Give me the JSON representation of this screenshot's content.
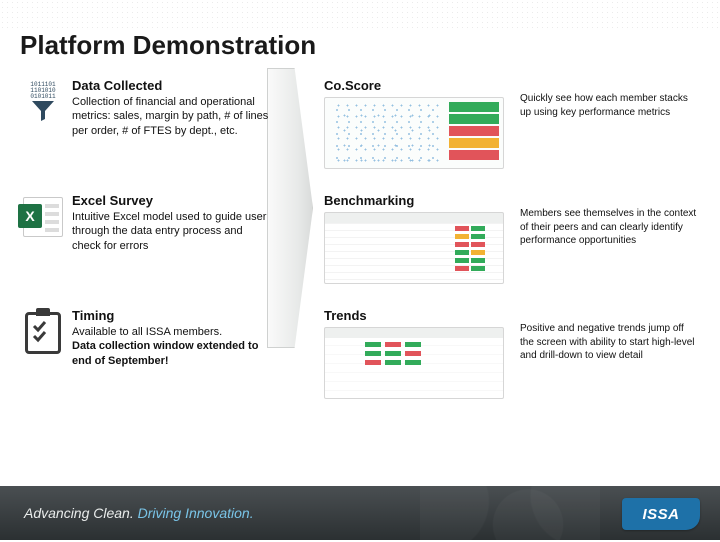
{
  "title": "Platform Demonstration",
  "left": [
    {
      "heading": "Data Collected",
      "body": "Collection of financial and operational metrics: sales, margin by path, # of lines per order, # of FTES by dept., etc."
    },
    {
      "heading": "Excel Survey",
      "body": "Intuitive Excel model used to guide user through the data entry process and check for errors"
    },
    {
      "heading": "Timing",
      "body": "Available to all ISSA members.",
      "body2": "Data collection window extended to end of September!"
    }
  ],
  "mid": [
    {
      "heading": "Co.Score"
    },
    {
      "heading": "Benchmarking"
    },
    {
      "heading": "Trends"
    }
  ],
  "right": [
    {
      "body": "Quickly see how each member stacks up using key performance metrics"
    },
    {
      "body": "Members see themselves in the context of their peers and can clearly identify performance opportunities"
    },
    {
      "body": "Positive and negative trends jump off the screen with ability to start high-level and drill-down to view detail"
    }
  ],
  "footer": {
    "part1": "Advancing Clean.",
    "part2": "Driving Innovation.",
    "badge": "ISSA"
  },
  "funnel_bits": "1011101\n1101010\n0101011"
}
